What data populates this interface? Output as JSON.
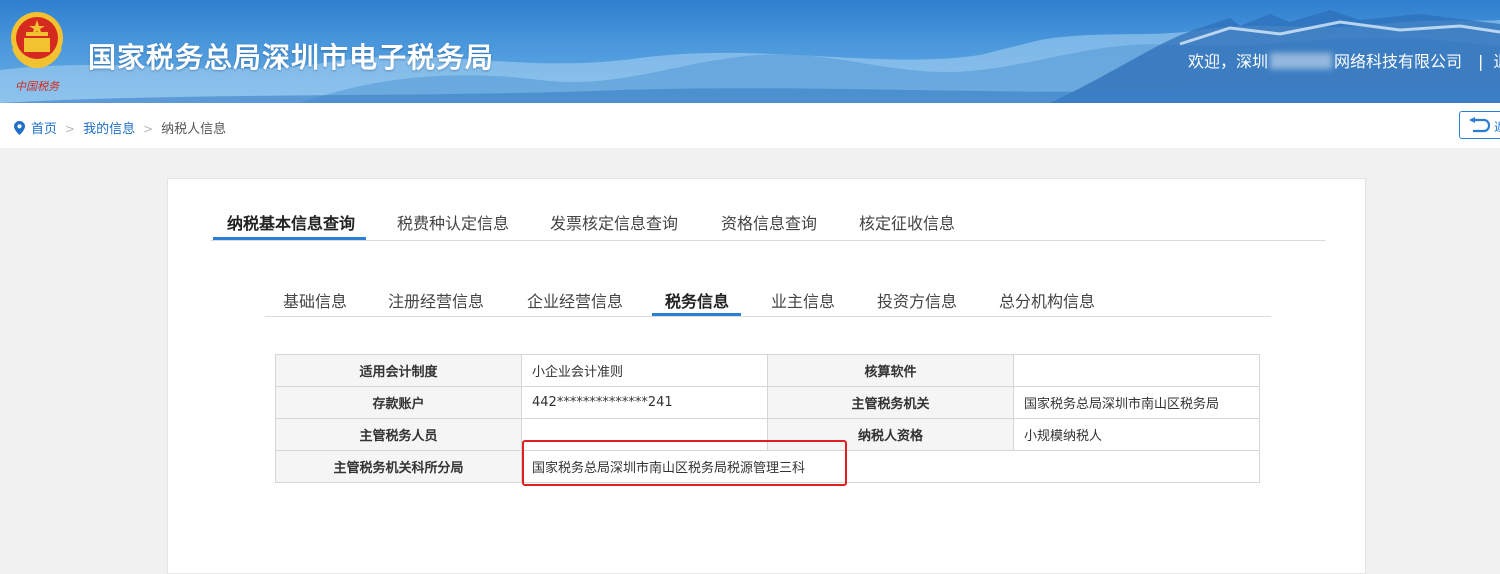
{
  "header": {
    "site_title": "国家税务总局深圳市电子税务局",
    "welcome_prefix": "欢迎，深圳",
    "welcome_suffix": "网络科技有限公司",
    "separator": "|",
    "cut_link": "退"
  },
  "breadcrumb": {
    "home": "首页",
    "my_info": "我的信息",
    "current": "纳税人信息",
    "arrow": ">"
  },
  "back_button": {
    "label": "返"
  },
  "main_tabs": [
    {
      "label": "纳税基本信息查询",
      "active": true
    },
    {
      "label": "税费种认定信息",
      "active": false
    },
    {
      "label": "发票核定信息查询",
      "active": false
    },
    {
      "label": "资格信息查询",
      "active": false
    },
    {
      "label": "核定征收信息",
      "active": false
    }
  ],
  "sub_tabs": [
    {
      "label": "基础信息",
      "active": false
    },
    {
      "label": "注册经营信息",
      "active": false
    },
    {
      "label": "企业经营信息",
      "active": false
    },
    {
      "label": "税务信息",
      "active": true
    },
    {
      "label": "业主信息",
      "active": false
    },
    {
      "label": "投资方信息",
      "active": false
    },
    {
      "label": "总分机构信息",
      "active": false
    }
  ],
  "tax_table": {
    "rows": [
      {
        "label1": "适用会计制度",
        "value1": "小企业会计准则",
        "label2": "核算软件",
        "value2": ""
      },
      {
        "label1": "存款账户",
        "value1": "442**************241",
        "label2": "主管税务机关",
        "value2": "国家税务总局深圳市南山区税务局"
      },
      {
        "label1": "主管税务人员",
        "value1": "",
        "label2": "纳税人资格",
        "value2": "小规模纳税人"
      },
      {
        "label1": "主管税务机关科所分局",
        "value1": "国家税务总局深圳市南山区税务局税源管理三科"
      }
    ]
  },
  "colors": {
    "header_blue": "#3a88d4",
    "accent_blue": "#2b7ed6",
    "highlight_red": "#e02020",
    "emblem_red": "#d42a1f",
    "emblem_gold": "#f2c230"
  },
  "icons": [
    "emblem-icon",
    "location-pin-icon",
    "back-arrow-icon"
  ]
}
